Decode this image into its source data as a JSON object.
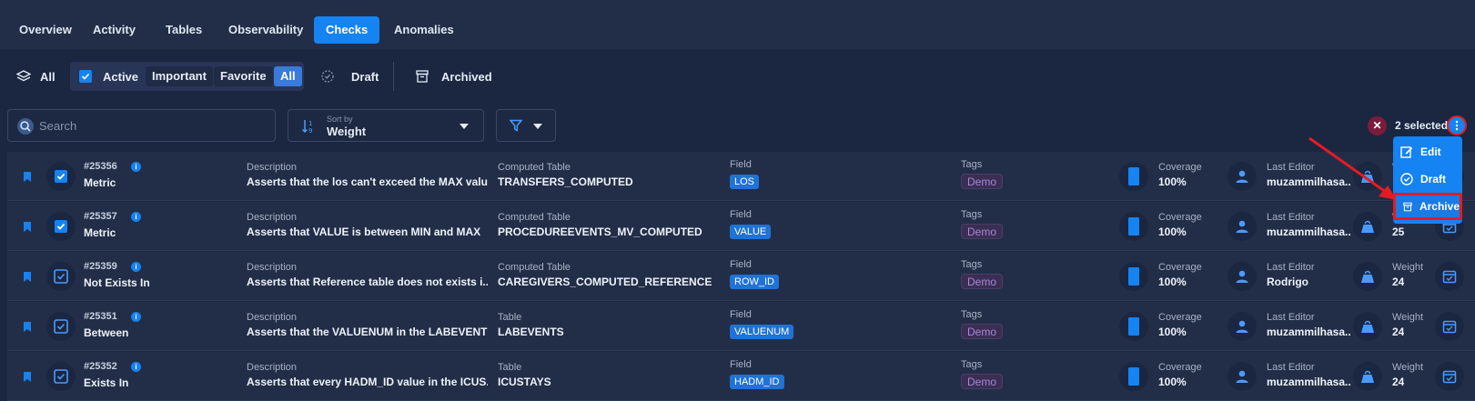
{
  "tabs": [
    {
      "label": "Overview"
    },
    {
      "label": "Activity"
    },
    {
      "label": "Tables"
    },
    {
      "label": "Observability"
    },
    {
      "label": "Checks"
    },
    {
      "label": "Anomalies"
    }
  ],
  "status": {
    "all": "All",
    "active": "Active",
    "important": "Important",
    "favorite": "Favorite",
    "all_sub": "All",
    "draft": "Draft",
    "archived": "Archived"
  },
  "search": {
    "placeholder": "Search",
    "value": ""
  },
  "sort": {
    "caption": "Sort by",
    "value": "Weight"
  },
  "selection": {
    "count_label": "2 selected"
  },
  "menu": {
    "edit": "Edit",
    "draft": "Draft",
    "archive": "Archive"
  },
  "labels": {
    "description": "Description",
    "field": "Field",
    "tags": "Tags",
    "coverage": "Coverage",
    "last_editor": "Last Editor",
    "weight": "Weight"
  },
  "rows": [
    {
      "id": "#25356",
      "rule": "Metric",
      "description": "Asserts that the los can't exceed the MAX valu...",
      "table_label": "Computed Table",
      "table": "TRANSFERS_COMPUTED",
      "field": "LOS",
      "tag": "Demo",
      "coverage": "100%",
      "editor": "muzammilhasa...",
      "weight": "",
      "checked": true
    },
    {
      "id": "#25357",
      "rule": "Metric",
      "description": "Asserts that VALUE is between MIN and MAX",
      "table_label": "Computed Table",
      "table": "PROCEDUREEVENTS_MV_COMPUTED",
      "field": "VALUE",
      "tag": "Demo",
      "coverage": "100%",
      "editor": "muzammilhasa...",
      "weight": "25",
      "checked": true
    },
    {
      "id": "#25359",
      "rule": "Not Exists In",
      "description": "Asserts that Reference table does not exists i...",
      "table_label": "Computed Table",
      "table": "CAREGIVERS_COMPUTED_REFERENCE",
      "field": "ROW_ID",
      "tag": "Demo",
      "coverage": "100%",
      "editor": "Rodrigo",
      "weight": "24",
      "checked": false
    },
    {
      "id": "#25351",
      "rule": "Between",
      "description": "Asserts that the VALUENUM in the LABEVENTS...",
      "table_label": "Table",
      "table": "LABEVENTS",
      "field": "VALUENUM",
      "tag": "Demo",
      "coverage": "100%",
      "editor": "muzammilhasa...",
      "weight": "24",
      "checked": false
    },
    {
      "id": "#25352",
      "rule": "Exists In",
      "description": "Asserts that every HADM_ID value in the ICUS...",
      "table_label": "Table",
      "table": "ICUSTAYS",
      "field": "HADM_ID",
      "tag": "Demo",
      "coverage": "100%",
      "editor": "muzammilhasa...",
      "weight": "24",
      "checked": false
    }
  ],
  "colors": {
    "accent": "#1583f1",
    "highlight": "#e31c24",
    "tag": "#a985d8"
  }
}
